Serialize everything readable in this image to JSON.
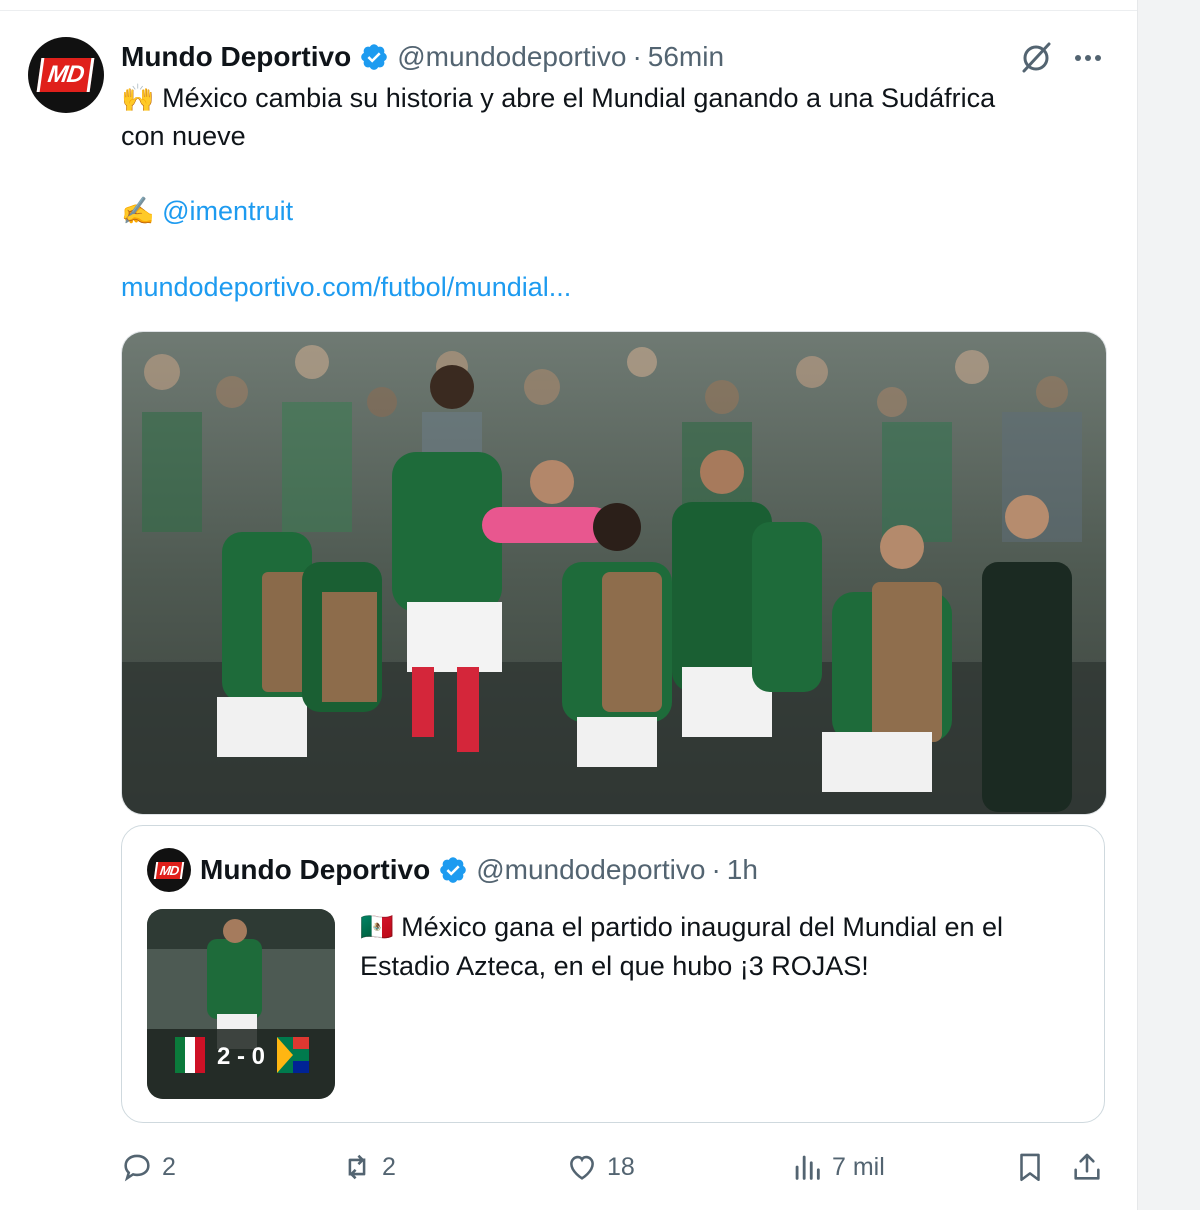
{
  "tweet": {
    "author_name": "Mundo Deportivo",
    "handle": "@mundodeportivo",
    "separator": "·",
    "time": "56min",
    "avatar_logo": "MD",
    "line1": "🙌 México cambia su historia y abre el Mundial ganando a una Sudáfrica",
    "line2": "con nueve",
    "mention_emoji": "✍️",
    "mention": "@imentruit",
    "url": "mundodeportivo.com/futbol/mundial..."
  },
  "quote": {
    "author_name": "Mundo Deportivo",
    "handle": "@mundodeportivo",
    "separator": "·",
    "time": "1h",
    "avatar_logo": "MD",
    "text_line1": "🇲🇽 México gana el partido inaugural del Mundial en el",
    "text_line2": "Estadio Azteca, en el que hubo ¡3 ROJAS!",
    "thumb_score": "2 - 0"
  },
  "actions": {
    "replies": "2",
    "reposts": "2",
    "likes": "18",
    "views": "7 mil"
  },
  "icons": {
    "verified": "verified-badge-icon",
    "grok": "grok-icon",
    "more": "more-icon",
    "reply": "reply-icon",
    "repost": "repost-icon",
    "like": "heart-icon",
    "views": "views-icon",
    "bookmark": "bookmark-icon",
    "share": "share-icon"
  },
  "colors": {
    "link": "#1d9bf0",
    "secondary_text": "#536471",
    "verified": "#1d9bf0",
    "brand_red": "#e0201b",
    "jersey_green": "#1e6b3a"
  }
}
